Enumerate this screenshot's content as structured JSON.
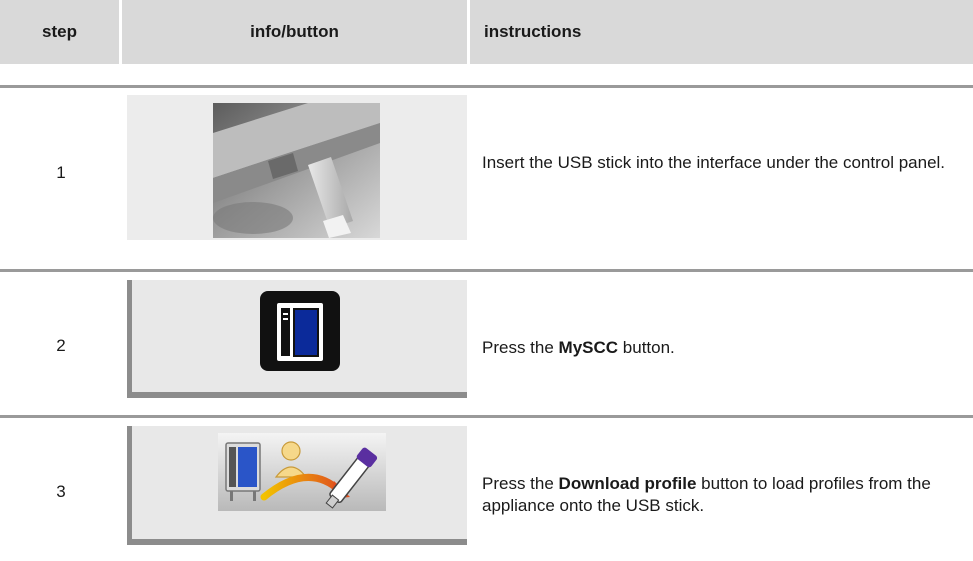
{
  "header": {
    "step": "step",
    "info_button": "info/button",
    "instructions": "instructions"
  },
  "rows": [
    {
      "step": "1",
      "icon": "usb-stick-photo",
      "instruction": "Insert the USB stick into the interface under the control panel."
    },
    {
      "step": "2",
      "icon": "myscc-appliance-icon",
      "instruction_parts": [
        "Press the ",
        "MySCC",
        " button."
      ]
    },
    {
      "step": "3",
      "icon": "download-profile-icon",
      "instruction_parts": [
        "Press the ",
        "Download profile",
        " button to load profiles from the appliance onto the USB stick."
      ]
    }
  ]
}
